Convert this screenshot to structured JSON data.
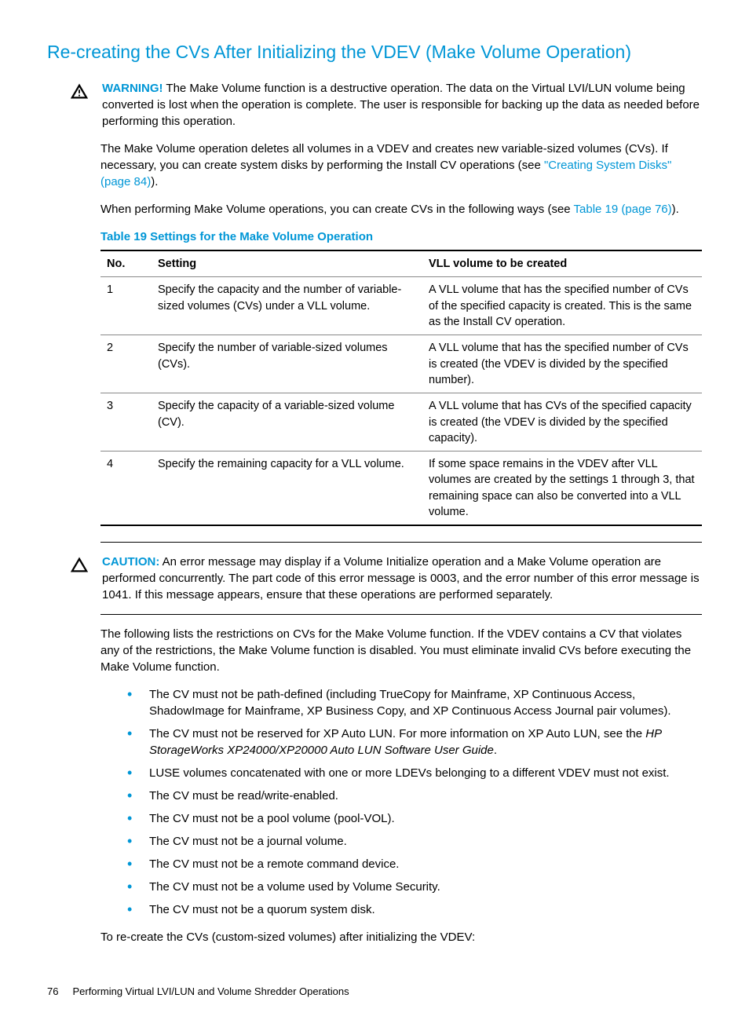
{
  "title": "Re-creating the CVs After Initializing the VDEV (Make Volume Operation)",
  "warning": {
    "label": "WARNING!",
    "text": "The Make Volume function is a destructive operation. The data on the Virtual LVI/LUN volume being converted is lost when the operation is complete. The user is responsible for backing up the data as needed before performing this operation."
  },
  "para1_a": "The Make Volume operation deletes all volumes in a VDEV and creates new variable-sized volumes (CVs). If necessary, you can create system disks by performing the Install CV operations (see ",
  "para1_link": "\"Creating System Disks\" (page 84)",
  "para1_b": ").",
  "para2_a": "When performing Make Volume operations, you can create CVs in the following ways (see ",
  "para2_link": "Table 19 (page 76)",
  "para2_b": ").",
  "table_title": "Table 19 Settings for the Make Volume Operation",
  "table": {
    "headers": [
      "No.",
      "Setting",
      "VLL volume to be created"
    ],
    "rows": [
      {
        "no": "1",
        "setting": "Specify the capacity and the number of variable-sized volumes (CVs) under a VLL volume.",
        "vll": "A VLL volume that has the specified number of CVs of the specified capacity is created. This is the same as the Install CV operation."
      },
      {
        "no": "2",
        "setting": "Specify the number of variable-sized volumes (CVs).",
        "vll": "A VLL volume that has the specified number of CVs is created (the VDEV is divided by the specified number)."
      },
      {
        "no": "3",
        "setting": "Specify the capacity of a variable-sized volume (CV).",
        "vll": "A VLL volume that has CVs of the specified capacity is created (the VDEV is divided by the specified capacity)."
      },
      {
        "no": "4",
        "setting": "Specify the remaining capacity for a VLL volume.",
        "vll": "If some space remains in the VDEV after VLL volumes are created by the settings 1 through 3, that remaining space can also be converted into a VLL volume."
      }
    ]
  },
  "caution": {
    "label": "CAUTION:",
    "text": "An error message may display if a Volume Initialize operation and a Make Volume operation are performed concurrently. The part code of this error message is 0003, and the error number of this error message is 1041. If this message appears, ensure that these operations are performed separately."
  },
  "para3": "The following lists the restrictions on CVs for the Make Volume function. If the VDEV contains a CV that violates any of the restrictions, the Make Volume function is disabled. You must eliminate invalid CVs before executing the Make Volume function.",
  "bullets": [
    {
      "text": "The CV must not be path-defined (including TrueCopy for Mainframe, XP Continuous Access, ShadowImage for Mainframe, XP Business Copy, and XP Continuous Access Journal pair volumes)."
    },
    {
      "text_a": "The CV must not be reserved for XP Auto LUN. For more information on XP Auto LUN, see the ",
      "italic": "HP StorageWorks XP24000/XP20000 Auto LUN Software User Guide",
      "text_b": "."
    },
    {
      "text": "LUSE volumes concatenated with one or more LDEVs belonging to a different VDEV must not exist."
    },
    {
      "text": "The CV must be read/write-enabled."
    },
    {
      "text": "The CV must not be a pool volume (pool-VOL)."
    },
    {
      "text": "The CV must not be a journal volume."
    },
    {
      "text": "The CV must not be a remote command device."
    },
    {
      "text": "The CV must not be a volume used by Volume Security."
    },
    {
      "text": "The CV must not be a quorum system disk."
    }
  ],
  "para4": "To re-create the CVs (custom-sized volumes) after initializing the VDEV:",
  "footer": {
    "page": "76",
    "text": "Performing Virtual LVI/LUN and Volume Shredder Operations"
  }
}
